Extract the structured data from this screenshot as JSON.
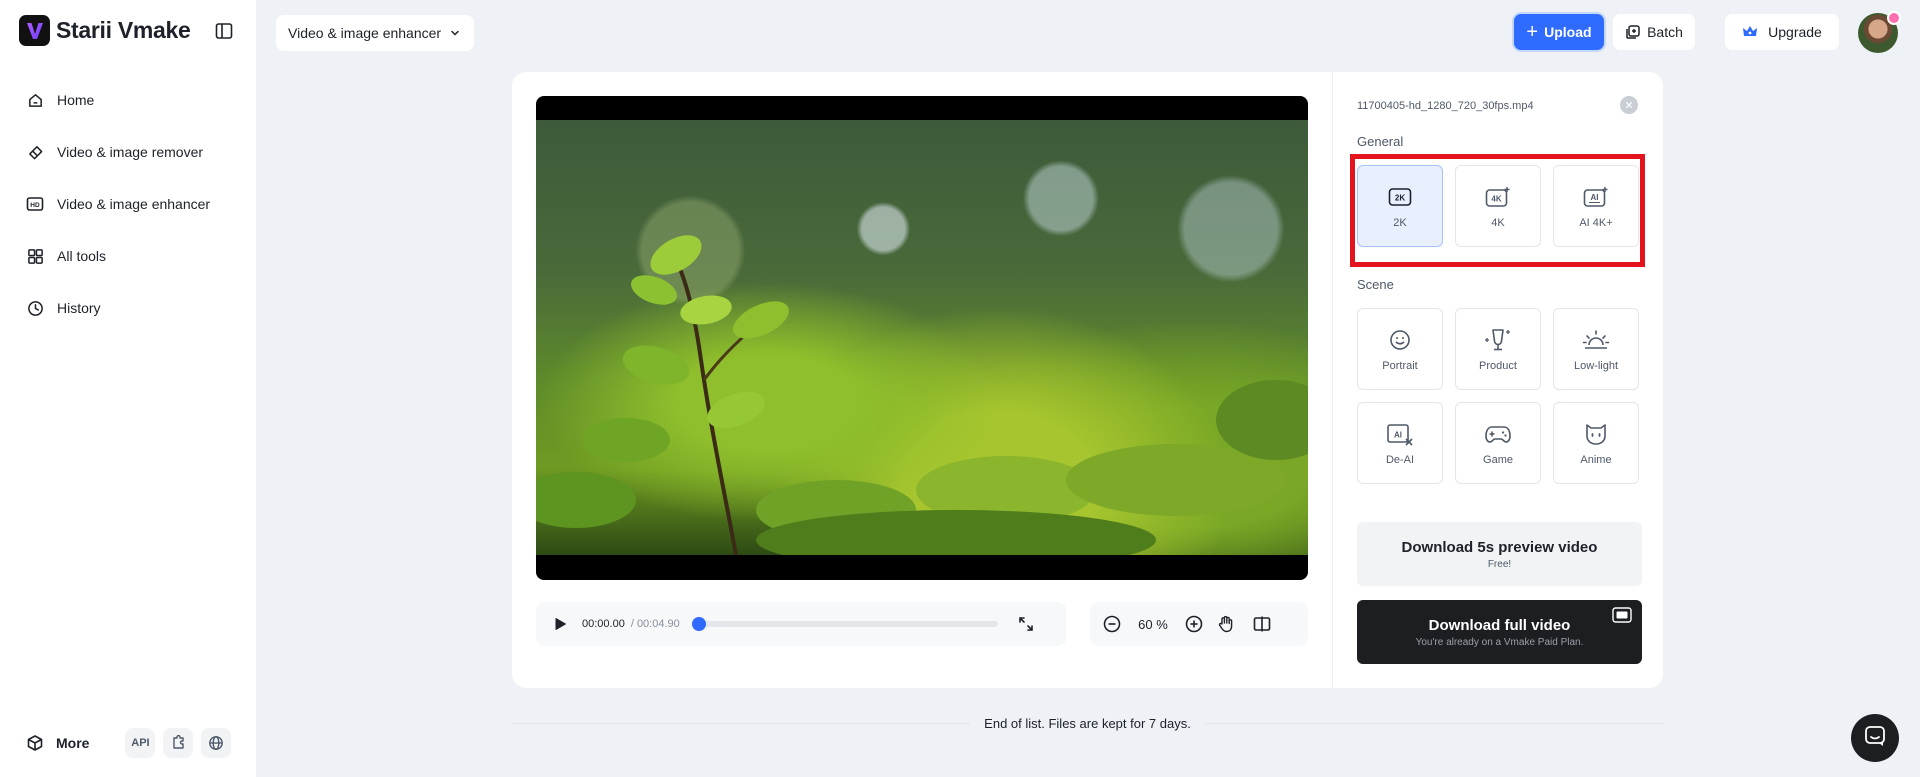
{
  "brand": {
    "name": "Starii Vmake"
  },
  "sidebar": {
    "items": [
      {
        "label": "Home",
        "icon": "home-icon"
      },
      {
        "label": "Video & image remover",
        "icon": "eraser-icon"
      },
      {
        "label": "Video & image enhancer",
        "icon": "hd-icon"
      },
      {
        "label": "All tools",
        "icon": "grid-icon"
      },
      {
        "label": "History",
        "icon": "clock-icon"
      }
    ],
    "more_label": "More",
    "api_label": "API"
  },
  "topbar": {
    "mode_label": "Video & image enhancer",
    "upload_label": "Upload",
    "batch_label": "Batch",
    "upgrade_label": "Upgrade"
  },
  "player": {
    "current_time": "00:00.00",
    "total_time": "/ 00:04.90",
    "progress": 0,
    "zoom": "60 %"
  },
  "panel": {
    "file_name": "11700405-hd_1280_720_30fps.mp4",
    "general_title": "General",
    "general_options": [
      {
        "label": "2K",
        "icon": "2k-icon",
        "selected": true
      },
      {
        "label": "4K",
        "icon": "4k-icon",
        "selected": false
      },
      {
        "label": "AI 4K+",
        "icon": "ai-4k-icon",
        "selected": false
      }
    ],
    "scene_title": "Scene",
    "scene_options": [
      {
        "label": "Portrait",
        "icon": "smile-icon"
      },
      {
        "label": "Product",
        "icon": "product-icon"
      },
      {
        "label": "Low-light",
        "icon": "sunrise-icon"
      },
      {
        "label": "De-AI",
        "icon": "de-ai-icon"
      },
      {
        "label": "Game",
        "icon": "gamepad-icon"
      },
      {
        "label": "Anime",
        "icon": "anime-icon"
      }
    ],
    "download_preview": {
      "title": "Download 5s preview video",
      "subtitle": "Free!"
    },
    "download_full": {
      "title": "Download full video",
      "subtitle": "You're already on a Vmake Paid Plan."
    }
  },
  "footer_note": "End of list. Files are kept for 7 days.",
  "colors": {
    "accent": "#2f6bff",
    "highlight": "#e3141e",
    "dark": "#1d1e22"
  }
}
